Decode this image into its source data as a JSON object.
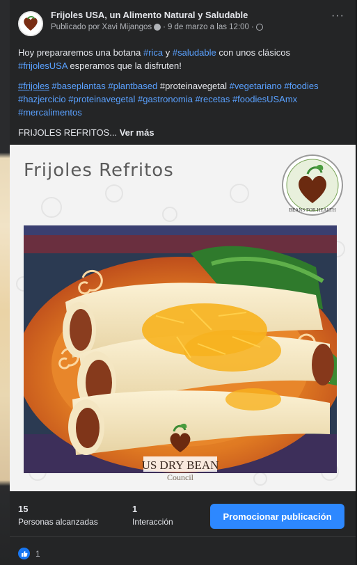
{
  "post": {
    "page_name": "Frijoles USA, un Alimento Natural y Saludable",
    "published_by": "Publicado por Xavi Mijangos",
    "date": "9 de marzo a las 12:00",
    "more": "···",
    "text_line1_a": "Hoy prepararemos una botana ",
    "tag_rica": "#rica",
    "text_line1_b": " y ",
    "tag_saludable": "#saludable",
    "text_line1_c": " con unos clásicos",
    "tag_frijolesusa": "#frijolesUSA",
    "text_line2": " esperamos que la disfruten!",
    "hashtags": {
      "frijoles": "#frijoles",
      "baseplantas": "#baseplantas",
      "plantbased": "#plantbased",
      "proteinavegetal_plain": "#proteinavegetal",
      "vegetariano": "#vegetariano",
      "foodies": "#foodies",
      "hazjercicio": "#hazjercicio",
      "proteinavegetal": "#proteinavegetal",
      "gastronomia": "#gastronomia",
      "recetas": "#recetas",
      "foodiesusamx": "#foodiesUSAmx",
      "mercalimentos": "#mercalimentos"
    },
    "teaser": "FRIJOLES REFRITOS... ",
    "see_more": "Ver más"
  },
  "image": {
    "title": "Frijoles Refritos",
    "beans_logo_text": "BEANS FOR HEALTH",
    "usdb_line1": "US DRY BEAN",
    "usdb_line2": "Council"
  },
  "stats": {
    "reach_count": "15",
    "reach_label": "Personas alcanzadas",
    "interaction_count": "1",
    "interaction_label": "Interacción",
    "promote_label": "Promocionar publicación"
  },
  "reactions": {
    "count": "1"
  },
  "colors": {
    "background": "#18191a",
    "card": "#242526",
    "link": "#5aa1ff",
    "primary_button": "#2d88ff"
  }
}
